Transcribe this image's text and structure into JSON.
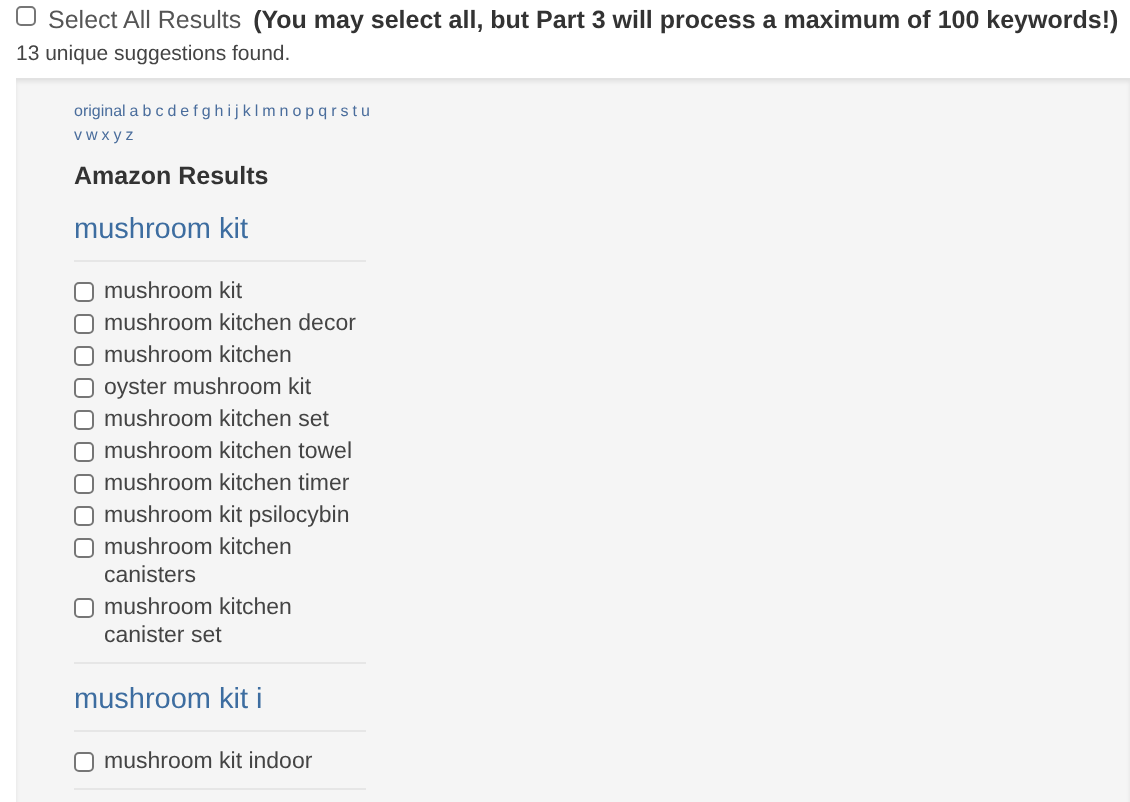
{
  "select_all": {
    "checked": false,
    "label": "Select All Results",
    "note": "(You may select all, but Part 3 will process a maximum of 100 keywords!)"
  },
  "summary": "13 unique suggestions found.",
  "letter_links": [
    "original",
    "a",
    "b",
    "c",
    "d",
    "e",
    "f",
    "g",
    "h",
    "i",
    "j",
    "k",
    "l",
    "m",
    "n",
    "o",
    "p",
    "q",
    "r",
    "s",
    "t",
    "u",
    "v",
    "w",
    "x",
    "y",
    "z"
  ],
  "source_title": "Amazon Results",
  "groups": [
    {
      "heading": "mushroom kit",
      "items": [
        {
          "label": "mushroom kit",
          "checked": false
        },
        {
          "label": "mushroom kitchen decor",
          "checked": false
        },
        {
          "label": "mushroom kitchen",
          "checked": false
        },
        {
          "label": "oyster mushroom kit",
          "checked": false
        },
        {
          "label": "mushroom kitchen set",
          "checked": false
        },
        {
          "label": "mushroom kitchen towel",
          "checked": false
        },
        {
          "label": "mushroom kitchen timer",
          "checked": false
        },
        {
          "label": "mushroom kit psilocybin",
          "checked": false
        },
        {
          "label": "mushroom kitchen canisters",
          "checked": false
        },
        {
          "label": "mushroom kitchen canister set",
          "checked": false
        }
      ]
    },
    {
      "heading": "mushroom kit i",
      "items": [
        {
          "label": "mushroom kit indoor",
          "checked": false
        }
      ]
    }
  ]
}
